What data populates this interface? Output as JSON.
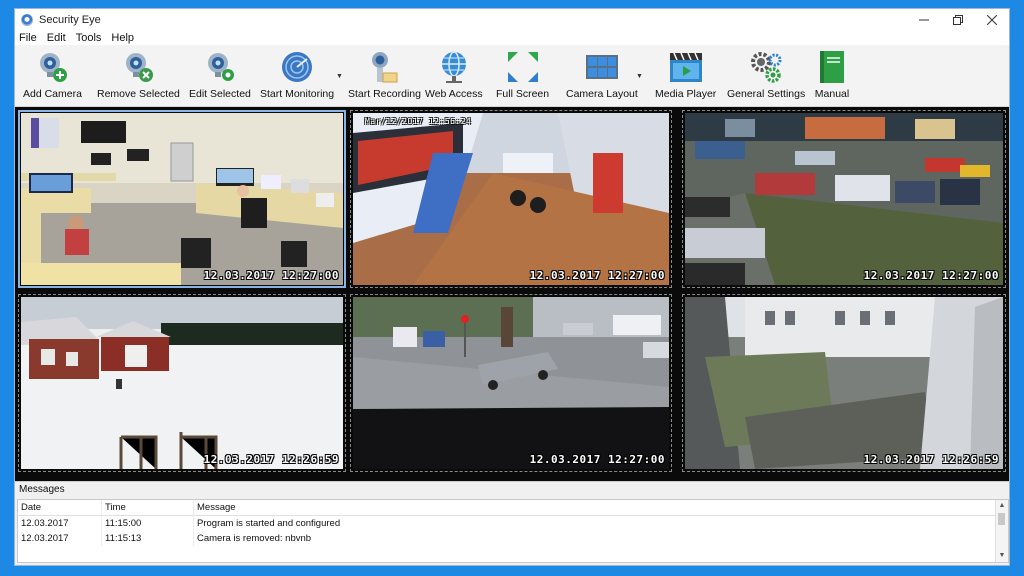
{
  "window": {
    "title": "Security Eye"
  },
  "menu": [
    "File",
    "Edit",
    "Tools",
    "Help"
  ],
  "toolbar": [
    {
      "label": "Add Camera",
      "icon": "add-camera-icon"
    },
    {
      "label": "Remove Selected",
      "icon": "remove-camera-icon"
    },
    {
      "label": "Edit Selected",
      "icon": "edit-camera-icon"
    },
    {
      "label": "Start Monitoring",
      "icon": "radar-icon"
    },
    {
      "label": "Start Recording",
      "icon": "record-camera-icon"
    },
    {
      "label": "Web Access",
      "icon": "globe-icon"
    },
    {
      "label": "Full Screen",
      "icon": "fullscreen-icon"
    },
    {
      "label": "Camera Layout",
      "icon": "layout-grid-icon"
    },
    {
      "label": "Media Player",
      "icon": "media-player-icon"
    },
    {
      "label": "General Settings",
      "icon": "gears-icon"
    },
    {
      "label": "Manual",
      "icon": "book-icon"
    }
  ],
  "cameras": [
    {
      "timestamp": "12.03.2017 12:27:00",
      "overlay": "",
      "selected": true
    },
    {
      "timestamp": "12.03.2017 12:27:00",
      "overlay": "Mar/12/2017  12:56:24",
      "selected": false
    },
    {
      "timestamp": "12.03.2017 12:27:00",
      "overlay": "",
      "selected": false
    },
    {
      "timestamp": "12.03.2017 12:26:59",
      "overlay": "",
      "selected": false
    },
    {
      "timestamp": "12.03.2017 12:27:00",
      "overlay": "",
      "selected": false
    },
    {
      "timestamp": "12.03.2017 12:26:59",
      "overlay": "",
      "selected": false
    }
  ],
  "messages": {
    "title": "Messages",
    "columns": [
      "Date",
      "Time",
      "Message"
    ],
    "rows": [
      {
        "date": "12.03.2017",
        "time": "11:15:00",
        "message": "Program is started and configured"
      },
      {
        "date": "12.03.2017",
        "time": "11:15:13",
        "message": "Camera is removed: nbvnb"
      }
    ]
  },
  "colors": {
    "background": "#1e88e5",
    "grid_background": "#0a0a0a",
    "selected_outline": "#8ab4e8"
  }
}
